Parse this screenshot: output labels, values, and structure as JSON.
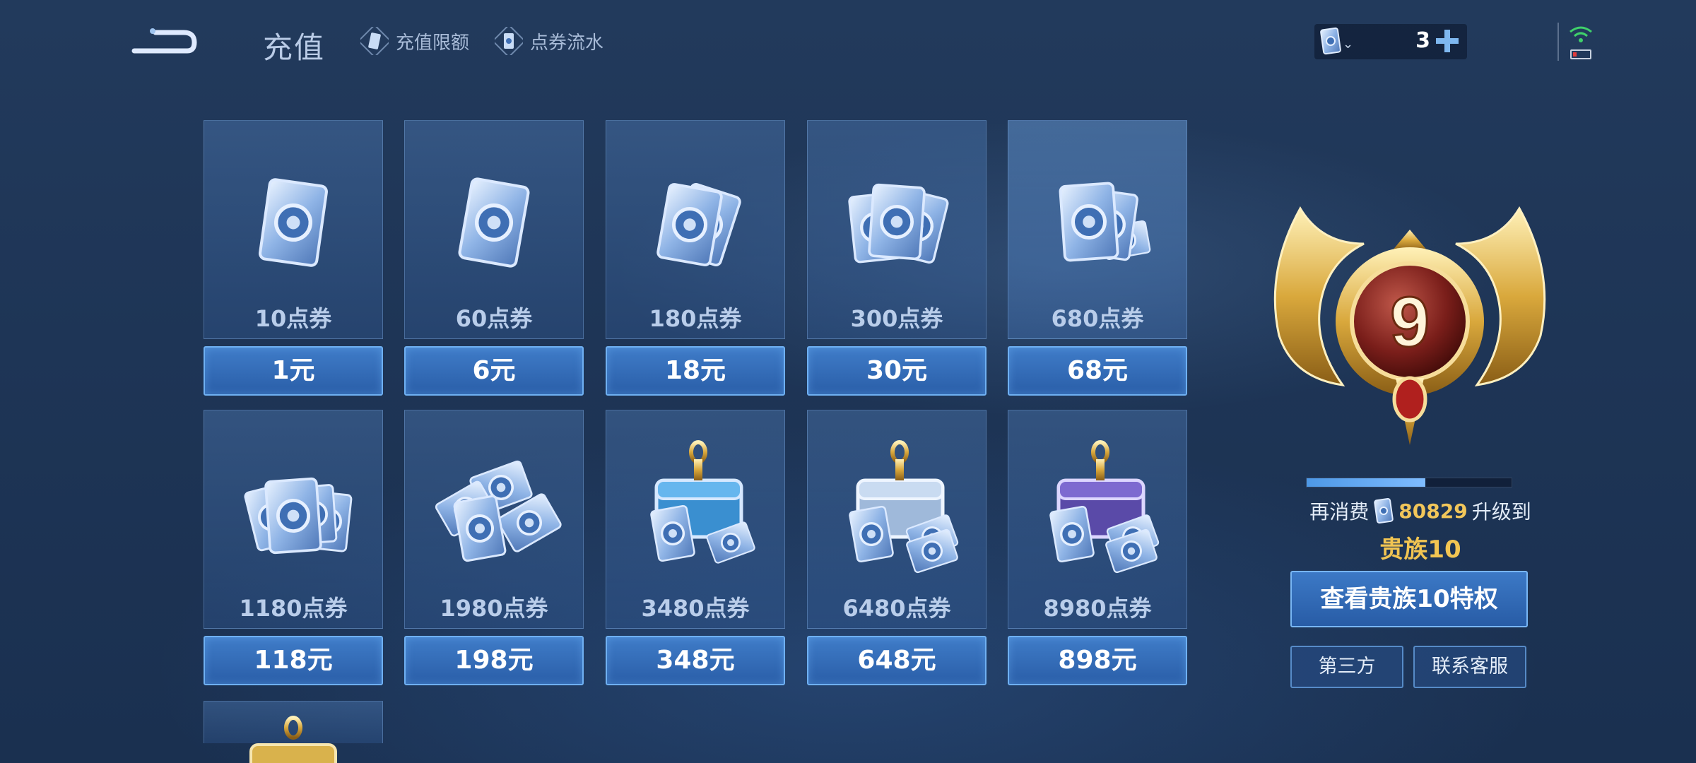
{
  "header": {
    "title": "充值",
    "links": [
      {
        "label": "充值限额",
        "icon": "card-icon"
      },
      {
        "label": "点券流水",
        "icon": "voucher-icon"
      }
    ]
  },
  "wallet": {
    "count": "3",
    "icon": "voucher-coin-icon",
    "plus_icon": "plus-icon"
  },
  "status": {
    "wifi": "wifi-icon",
    "battery": "battery-low-icon"
  },
  "products": [
    {
      "amount": "10点券",
      "price": "1元",
      "art": "single-card"
    },
    {
      "amount": "60点券",
      "price": "6元",
      "art": "single-card"
    },
    {
      "amount": "180点券",
      "price": "18元",
      "art": "double-card"
    },
    {
      "amount": "300点券",
      "price": "30元",
      "art": "triple-card"
    },
    {
      "amount": "680点券",
      "price": "68元",
      "art": "card-bundle"
    },
    {
      "amount": "1180点券",
      "price": "118元",
      "art": "card-pile"
    },
    {
      "amount": "1980点券",
      "price": "198元",
      "art": "card-stacks"
    },
    {
      "amount": "3480点券",
      "price": "348元",
      "art": "chest-blue"
    },
    {
      "amount": "6480点券",
      "price": "648元",
      "art": "chest-silver"
    },
    {
      "amount": "8980点券",
      "price": "898元",
      "art": "chest-purple"
    },
    {
      "amount": "",
      "price": "",
      "art": "chest-gold"
    }
  ],
  "noble": {
    "level": "9",
    "progress": 0.58,
    "spend_prefix": "再消费",
    "spend_amount": "80829",
    "spend_suffix": "升级到",
    "next_level_label": "贵族10",
    "privilege_button": "查看贵族10特权",
    "third_party_button": "第三方",
    "service_button": "联系客服"
  },
  "colors": {
    "accent": "#3f7cc8",
    "gold": "#f2c552",
    "background": "#1e3556"
  }
}
